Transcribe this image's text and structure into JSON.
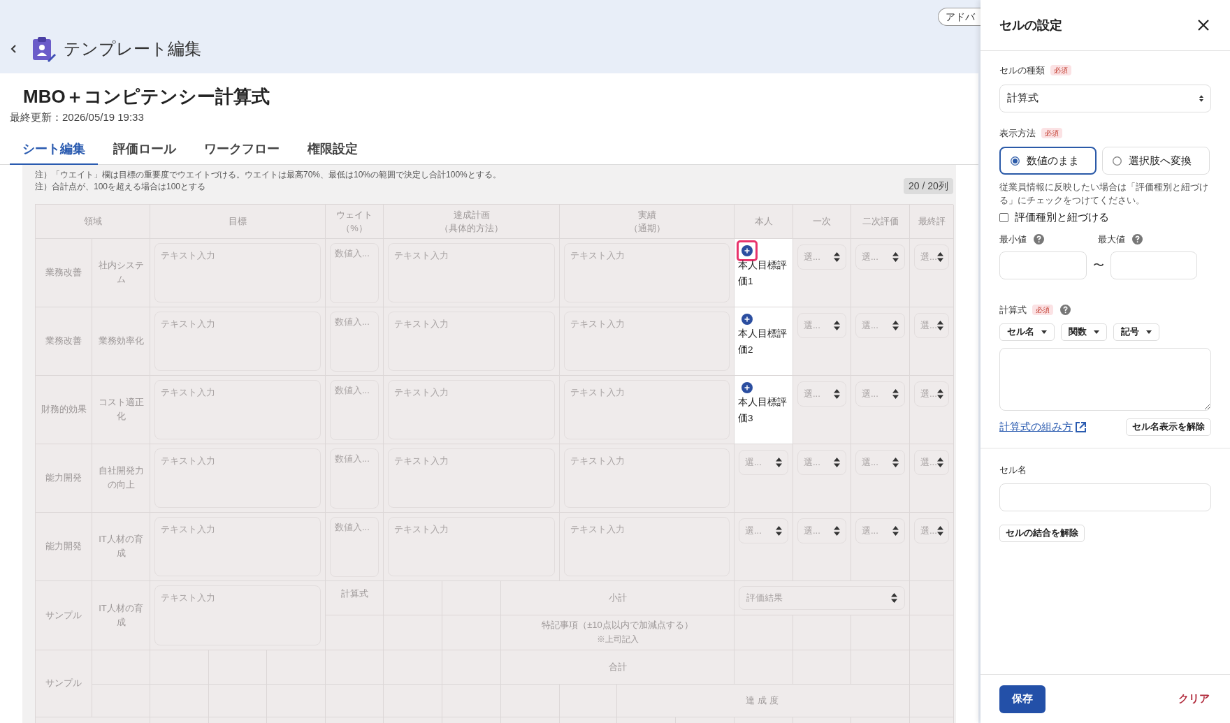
{
  "header": {
    "title": "テンプレート編集",
    "advanced_button": "アドバ"
  },
  "page": {
    "title": "MBO＋コンピテンシー計算式",
    "updated": "最終更新：2026/05/19 19:33"
  },
  "tabs": [
    {
      "label": "シート編集",
      "selected": true
    },
    {
      "label": "評価ロール",
      "selected": false
    },
    {
      "label": "ワークフロー",
      "selected": false
    },
    {
      "label": "権限設定",
      "selected": false
    }
  ],
  "notes": [
    "注）「ウエイト」欄は目標の重要度でウエイトづける。ウエイトは最高70%、最低は10%の範囲で決定し合計100%とする。",
    "注）合計点が、100を超える場合は100とする"
  ],
  "column_count": "20 / 20列",
  "table": {
    "columns": [
      {
        "label": "領域"
      },
      {
        "label": "目標"
      },
      {
        "label": "ウェイト",
        "sub": "（%）"
      },
      {
        "label": "達成計画",
        "sub": "（具体的方法）"
      },
      {
        "label": "実績",
        "sub": "（通期）"
      },
      {
        "label": "本人"
      },
      {
        "label": "一次"
      },
      {
        "label": "二次評価"
      },
      {
        "label": "最終評"
      }
    ],
    "rows": [
      {
        "area": "業務改善",
        "subarea": "社内システム",
        "goal_placeholder": "テキスト入力",
        "weight_placeholder": "数値入...",
        "plan_placeholder": "テキスト入力",
        "result_placeholder": "テキスト入力",
        "self": {
          "kind": "label",
          "text": "本人目標評価1",
          "highlighted": true
        },
        "first": "選...",
        "second": "選...",
        "final": "選..."
      },
      {
        "area": "業務改善",
        "subarea": "業務効率化",
        "goal_placeholder": "テキスト入力",
        "weight_placeholder": "数値入...",
        "plan_placeholder": "テキスト入力",
        "result_placeholder": "テキスト入力",
        "self": {
          "kind": "label",
          "text": "本人目標評価2",
          "highlighted": false
        },
        "first": "選...",
        "second": "選...",
        "final": "選..."
      },
      {
        "area": "財務的効果",
        "subarea": "コスト適正化",
        "goal_placeholder": "テキスト入力",
        "weight_placeholder": "数値入...",
        "plan_placeholder": "テキスト入力",
        "result_placeholder": "テキスト入力",
        "self": {
          "kind": "label",
          "text": "本人目標評価3",
          "highlighted": false
        },
        "first": "選...",
        "second": "選...",
        "final": "選..."
      },
      {
        "area": "能力開発",
        "subarea": "自社開発力の向上",
        "goal_placeholder": "テキスト入力",
        "weight_placeholder": "数値入...",
        "plan_placeholder": "テキスト入力",
        "result_placeholder": "テキスト入力",
        "self": {
          "kind": "select",
          "text": "選..."
        },
        "first": "選...",
        "second": "選...",
        "final": "選..."
      },
      {
        "area": "能力開発",
        "subarea": "IT人材の育成",
        "goal_placeholder": "テキスト入力",
        "weight_placeholder": "数値入...",
        "plan_placeholder": "テキスト入力",
        "result_placeholder": "テキスト入力",
        "self": {
          "kind": "select",
          "text": "選..."
        },
        "first": "選...",
        "second": "選...",
        "final": "選..."
      }
    ],
    "sample_row": {
      "area": "サンプル",
      "subarea": "IT人材の育成",
      "goal_placeholder": "テキスト入力",
      "formula": "計算式",
      "subtotal": "小計",
      "result_select": "評価結果",
      "note": "特記事項（±10点以内で加減点する）",
      "note_sub": "※上司記入"
    },
    "total_row": {
      "area": "サンプル",
      "total": "合計",
      "achievement": "達成度"
    }
  },
  "panel": {
    "title": "セルの設定",
    "cell_type": {
      "label": "セルの種類",
      "required": "必須",
      "value": "計算式"
    },
    "display": {
      "label": "表示方法",
      "required": "必須",
      "options": [
        {
          "label": "数値のまま",
          "selected": true
        },
        {
          "label": "選択肢へ変換",
          "selected": false
        }
      ],
      "help": "従業員情報に反映したい場合は「評価種別と紐づける」にチェックをつけてください。",
      "link_checkbox": {
        "label": "評価種別と紐づける",
        "checked": false
      }
    },
    "min_label": "最小値",
    "range_separator": "〜",
    "max_label": "最大値",
    "formula": {
      "label": "計算式",
      "required": "必須",
      "menus": [
        "セル名",
        "関数",
        "記号"
      ],
      "guide_link": "計算式の組み方",
      "hide_names_button": "セル名表示を解除"
    },
    "cell_name_label": "セル名",
    "unmerge_button": "セルの結合を解除",
    "save_button": "保存",
    "clear_button": "クリア"
  }
}
